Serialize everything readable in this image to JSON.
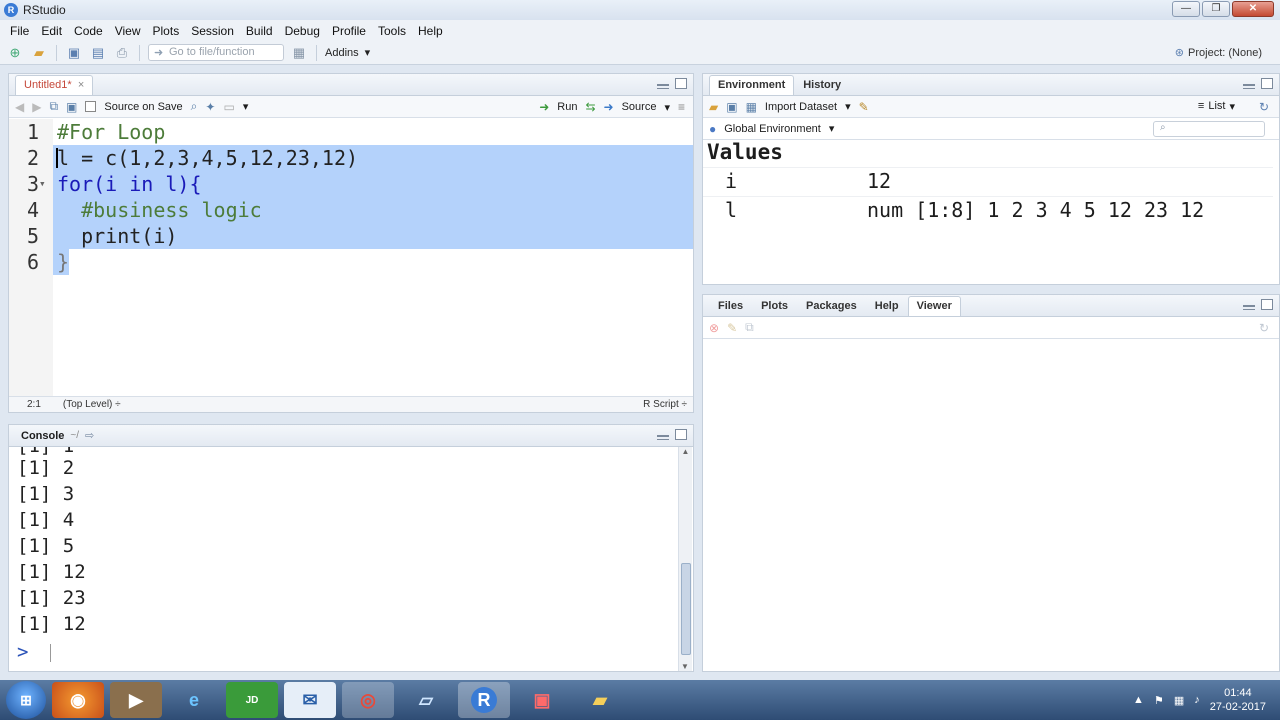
{
  "window": {
    "title": "RStudio",
    "min": "—",
    "max": "❐",
    "close": "✕"
  },
  "menu": [
    "File",
    "Edit",
    "Code",
    "View",
    "Plots",
    "Session",
    "Build",
    "Debug",
    "Profile",
    "Tools",
    "Help"
  ],
  "toolbar": {
    "goto_placeholder": "Go to file/function",
    "addins": "Addins",
    "project": "Project: (None)"
  },
  "editor": {
    "tab": "Untitled1*",
    "source_on_save": "Source on Save",
    "run": "Run",
    "source": "Source",
    "lines": [
      {
        "n": "1",
        "text": "#For Loop"
      },
      {
        "n": "2",
        "text": "l = c(1,2,3,4,5,12,23,12)"
      },
      {
        "n": "3",
        "text": "for(i in l){"
      },
      {
        "n": "4",
        "text": "  #business logic"
      },
      {
        "n": "5",
        "text": "  print(i)"
      },
      {
        "n": "6",
        "text": "}"
      }
    ],
    "status_pos": "2:1",
    "status_scope": "(Top Level) ÷",
    "status_type": "R Script ÷"
  },
  "console": {
    "title": "Console",
    "path": "~/",
    "lines": [
      "[1] 2",
      "[1] 3",
      "[1] 4",
      "[1] 5",
      "[1] 12",
      "[1] 23",
      "[1] 12"
    ],
    "prompt": ">"
  },
  "environment": {
    "tabs": [
      "Environment",
      "History"
    ],
    "import": "Import Dataset",
    "list": "List",
    "scope": "Global Environment",
    "section": "Values",
    "rows": [
      {
        "name": "i",
        "value": "12"
      },
      {
        "name": "l",
        "value": "num [1:8] 1 2 3 4 5 12 23 12"
      }
    ]
  },
  "viewer": {
    "tabs": [
      "Files",
      "Plots",
      "Packages",
      "Help",
      "Viewer"
    ]
  },
  "taskbar": {
    "time": "01:44",
    "date": "27-02-2017"
  }
}
